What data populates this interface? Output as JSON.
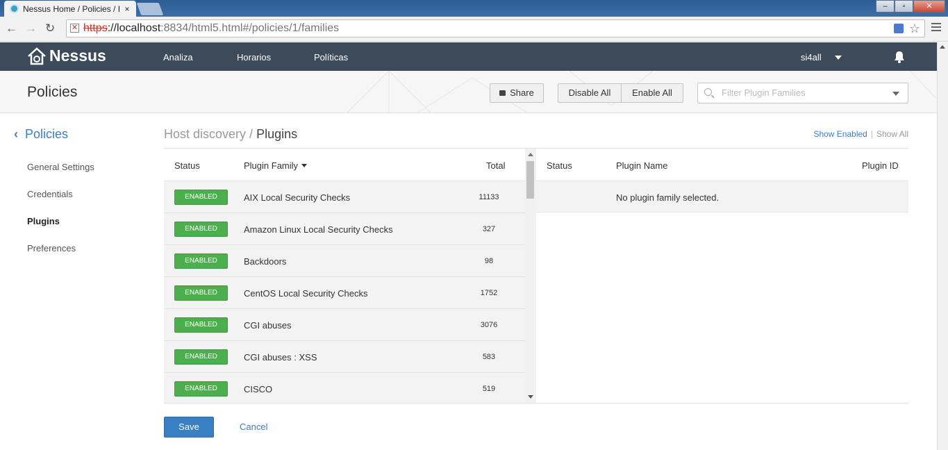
{
  "browser": {
    "tab_title": "Nessus Home / Policies / I",
    "tab_close": "×",
    "url_scheme": "https",
    "url_host": "://localhost",
    "url_rest": ":8834/html5.html#/policies/1/families",
    "back_icon": "←",
    "forward_icon": "→",
    "reload_icon": "↻",
    "star_icon": "☆",
    "win_min": "–",
    "win_max": "▫",
    "win_close": "✕"
  },
  "app": {
    "logo_text": "Nessus",
    "nav": [
      "Analiza",
      "Horarios",
      "Políticas"
    ],
    "user": "si4all"
  },
  "page_header": {
    "title": "Policies",
    "share_label": "Share",
    "disable_all_label": "Disable All",
    "enable_all_label": "Enable All",
    "filter_placeholder": "Filter Plugin Families"
  },
  "sidebar": {
    "back_label": "Policies",
    "back_icon": "‹",
    "items": [
      {
        "label": "General Settings",
        "active": false
      },
      {
        "label": "Credentials",
        "active": false
      },
      {
        "label": "Plugins",
        "active": true
      },
      {
        "label": "Preferences",
        "active": false
      }
    ]
  },
  "content": {
    "breadcrumb_parent": "Host discovery /",
    "breadcrumb_current": "Plugins",
    "show_enabled": "Show Enabled",
    "separator": "|",
    "show_all": "Show All"
  },
  "families_table": {
    "columns": {
      "status": "Status",
      "family": "Plugin Family",
      "total": "Total"
    },
    "rows": [
      {
        "status": "ENABLED",
        "family": "AIX Local Security Checks",
        "total": "11133"
      },
      {
        "status": "ENABLED",
        "family": "Amazon Linux Local Security Checks",
        "total": "327"
      },
      {
        "status": "ENABLED",
        "family": "Backdoors",
        "total": "98"
      },
      {
        "status": "ENABLED",
        "family": "CentOS Local Security Checks",
        "total": "1752"
      },
      {
        "status": "ENABLED",
        "family": "CGI abuses",
        "total": "3076"
      },
      {
        "status": "ENABLED",
        "family": "CGI abuses : XSS",
        "total": "583"
      },
      {
        "status": "ENABLED",
        "family": "CISCO",
        "total": "519"
      }
    ]
  },
  "plugins_table": {
    "columns": {
      "status": "Status",
      "name": "Plugin Name",
      "id": "Plugin ID"
    },
    "empty_message": "No plugin family selected."
  },
  "footer": {
    "save_label": "Save",
    "cancel_label": "Cancel"
  },
  "colors": {
    "appbar": "#3c4a5a",
    "accent": "#3a7fc1",
    "enabled_badge": "#4cae4c"
  }
}
